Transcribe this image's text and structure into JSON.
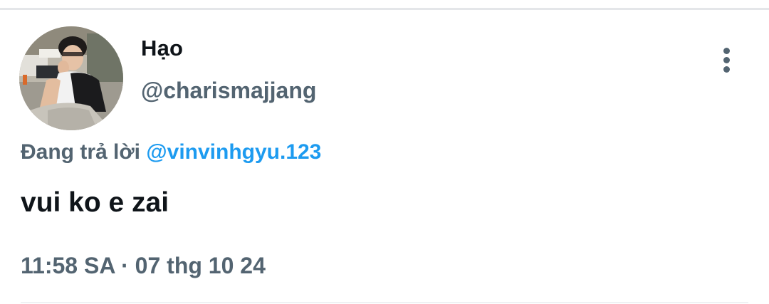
{
  "tweet": {
    "author": {
      "display_name": "Hạo",
      "handle": "@charismajjang"
    },
    "reply": {
      "prefix": "Đang trả lời",
      "mention": "@vinvinhgyu.123"
    },
    "text": "vui ko e zai",
    "time": "11:58 SA",
    "separator": "·",
    "date": "07 thg 10 24"
  },
  "icons": {
    "more": "more-vertical-icon"
  },
  "colors": {
    "primary_text": "#0f1419",
    "secondary_text": "#536471",
    "link": "#1d9bf0",
    "divider": "#e4e6e9"
  }
}
